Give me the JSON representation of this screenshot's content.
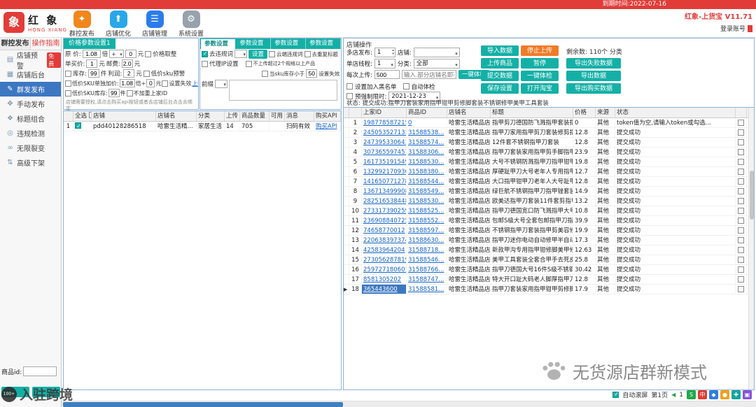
{
  "titlebar": {
    "expiry": "到期时间:2022-07-16",
    "version": "红象-上货宝 V11.71",
    "login": "登录账号"
  },
  "logo": {
    "glyph": "象",
    "title": "红 象",
    "sub": "HONG XIANG"
  },
  "toolbar": {
    "items": [
      {
        "label": "群控发布",
        "glyph": "✦",
        "color": "#f0861c"
      },
      {
        "label": "店铺优化",
        "glyph": "⬆",
        "color": "#29a7e8"
      },
      {
        "label": "店铺管理",
        "glyph": "☰",
        "color": "#2a7de8"
      },
      {
        "label": "系统设置",
        "glyph": "⚙",
        "color": "#97a2ad"
      }
    ]
  },
  "sidebar": {
    "tab1": "群控发布",
    "tab2": "操作指南",
    "items": [
      {
        "icon": "▤",
        "label": "店铺预警",
        "badge": "免费"
      },
      {
        "icon": "▦",
        "label": "店铺后台"
      },
      {
        "icon": "✎",
        "label": "群发发布",
        "selected": true
      },
      {
        "icon": "✥",
        "label": "手动发布"
      },
      {
        "icon": "❖",
        "label": "标题组合"
      },
      {
        "icon": "◎",
        "label": "违规检测"
      },
      {
        "icon": "∞",
        "label": "无限裂变"
      },
      {
        "icon": "⇅",
        "label": "高级下架"
      }
    ],
    "product_id_label": "商品id:"
  },
  "price_panel": {
    "tab": "价格参数设置1",
    "r1": {
      "label": "原 价:",
      "v1": "1.08",
      "u1": "倍",
      "op": "+",
      "v2": "0",
      "u2": "元",
      "cb": "价格取整"
    },
    "r2": {
      "label": "单买价:",
      "v1": "1",
      "u1": "元",
      "label2": "邮费:",
      "v2": "2.0",
      "u2": "元"
    },
    "r3": {
      "cb": "库存:",
      "v1": "99",
      "u1": "件",
      "label2": "利润:",
      "v2": "2",
      "u2": "元",
      "cb2": "低价sku预警"
    },
    "r4": {
      "cb": "低价SKU单独加价:",
      "v1": "1.08",
      "mid": "倍+",
      "v2": "0",
      "u2": "元",
      "cb2": "设置失效",
      "link": "上传"
    },
    "r5": {
      "cb": "低价SKU库存:",
      "v1": "99",
      "u1": "件",
      "cb2": "不加重上家ID"
    },
    "note": "店铺需要授权,请点击购买api按钮或者去店铺后台点击去绑定"
  },
  "params_panel": {
    "tabs": [
      {
        "label": "参数设置1",
        "selected": true
      },
      {
        "label": "参数设置2"
      },
      {
        "label": "参数设置3"
      },
      {
        "label": "参数设置4"
      }
    ],
    "cb_qwgc": "去违规词",
    "btn_set": "设置",
    "cb_cloud": "云端违规词",
    "cb_dedup": "去重复标题",
    "cb_proxy": "代理IP设置",
    "cb_limit": "不上传超过2个规格以上产品",
    "cb_sku": "当sku库存小于",
    "sku_v1": "50",
    "sku_mid": "设置失效",
    "sku_v2": "0",
    "prefix_label": "前缀"
  },
  "store_table": {
    "headers": [
      "全选",
      "店铺",
      "店铺名",
      "分类",
      "上传",
      "商品数量",
      "可用",
      "消息",
      "购买API"
    ],
    "rows": [
      {
        "store": "pdd40128286518",
        "name": "哈雷生活精...",
        "cat": "家居生活",
        "up": "14",
        "cnt": "705",
        "avail": "",
        "msg": "扫码有效",
        "api": "购买API",
        "checked": true
      }
    ]
  },
  "ops": {
    "title": "店铺操作",
    "r1_label": "多店发布:",
    "r1_value": "1",
    "r1_label2": "店铺:",
    "r2_label": "单店线程:",
    "r2_value": "1",
    "r2_label2": "分类:",
    "r2_value2": "全部",
    "r3_label": "每次上传:",
    "r3_value": "500",
    "r3_placeholder": "输入.部分店铺名即可",
    "r3_btn": "一键体检",
    "cb_blacklist": "设置加入黑名单",
    "cb_autocheck": "自动体检",
    "cb_presale": "预强制限时:",
    "presale_date": "2021-12-23",
    "remaining": "剩余数: 110个  分类",
    "grid_buttons": [
      {
        "label": "导入数据"
      },
      {
        "label": "停止上传",
        "orange": true
      },
      {
        "label": "上传商品"
      },
      {
        "label": "暂停"
      },
      {
        "label": "提交数据"
      },
      {
        "label": "一键体检"
      },
      {
        "label": "保存设置"
      },
      {
        "label": "打开淘宝"
      }
    ],
    "export_buttons": [
      {
        "label": "导出失败数据"
      },
      {
        "label": "导出数据"
      },
      {
        "label": "导出购买数据"
      }
    ],
    "status": "状态:  提交成功:指甲刀套装家用指甲钳甲剪修脚套装不锈钢修甲美甲工具套装"
  },
  "products": {
    "headers": [
      "上家ID",
      "商品ID",
      "店铺名",
      "标题",
      "价格",
      "来源",
      "状态"
    ],
    "rows": [
      {
        "sid": "198778587215",
        "pid": "0",
        "store": "哈雷生活精品店",
        "title": "指甲剪刀德国防飞溅指甲套装指甲...",
        "price": "0",
        "source": "其他",
        "status": "token值为空,请输入token或勾选..."
      },
      {
        "sid": "245053527133",
        "pid": "31588538...",
        "store": "哈雷生活精品店",
        "title": "指甲刀家用指甲剪刀套装修剪指甲...",
        "price": "12.8",
        "source": "其他",
        "status": "提交成功"
      },
      {
        "sid": "247395330641",
        "pid": "31588574...",
        "store": "哈雷生活精品店",
        "title": "12件套不锈钢指甲刀套装",
        "price": "12.8",
        "source": "其他",
        "status": "提交成功"
      },
      {
        "sid": "307365597457",
        "pid": "31588306...",
        "store": "哈雷生活精品店",
        "title": "指甲刀套装家用指甲剪手脚指甲拉...",
        "price": "23.9",
        "source": "其他",
        "status": "提交成功"
      },
      {
        "sid": "161735191549",
        "pid": "31588530...",
        "store": "哈雷生活精品店",
        "title": "大号不锈钢防溅指甲刀指甲钳甲...",
        "price": "19.8",
        "source": "其他",
        "status": "提交成功"
      },
      {
        "sid": "132992170930",
        "pid": "31588380...",
        "store": "哈雷生活精品店",
        "title": "厚硬趾甲刀大号老年人专用指甲钳修...",
        "price": "12.7",
        "source": "其他",
        "status": "提交成功"
      },
      {
        "sid": "141650771278",
        "pid": "31588544...",
        "store": "哈雷生活精品店",
        "title": "大口指甲钳甲刀老年人大号趾甲...",
        "price": "12.8",
        "source": "其他",
        "status": "提交成功"
      },
      {
        "sid": "136713499908",
        "pid": "31588549...",
        "store": "哈雷生活精品店",
        "title": "绿巨航不锈钢指甲刀指甲锉套装...",
        "price": "14.9",
        "source": "其他",
        "status": "提交成功"
      },
      {
        "sid": "282516538448",
        "pid": "31588530...",
        "store": "哈雷生活精品店",
        "title": "欧美达指甲刀套装11件套剪指甲...",
        "price": "13.2",
        "source": "其他",
        "status": "提交成功"
      },
      {
        "sid": "273317390259",
        "pid": "31588525...",
        "store": "哈雷生活精品店",
        "title": "指甲刀德国宽口防飞溅指甲大号...",
        "price": "10.8",
        "source": "其他",
        "status": "提交成功"
      },
      {
        "sid": "236908840725",
        "pid": "31588552...",
        "store": "哈雷生活精品店",
        "title": "包邮S级大号全套包邮指甲刀指甲...",
        "price": "39.9",
        "source": "其他",
        "status": "提交成功"
      },
      {
        "sid": "74658770012",
        "pid": "31588597...",
        "store": "哈雷生活精品店",
        "title": "不锈钢指甲刀套装指甲剪美容修甲...",
        "price": "19.9",
        "source": "其他",
        "status": "提交成功"
      },
      {
        "sid": "220638397374",
        "pid": "31588630...",
        "store": "哈雷生活精品店",
        "title": "指甲刀迷你电动自动修甲半自动指...",
        "price": "17.3",
        "source": "其他",
        "status": "提交成功"
      },
      {
        "sid": "42583964204",
        "pid": "31588718...",
        "store": "哈雷生活精品店",
        "title": "新款甲沟专用指甲钳修脚美甲修复...",
        "price": "12.63",
        "source": "其他",
        "status": "提交成功"
      },
      {
        "sid": "273056287819",
        "pid": "31588546...",
        "store": "哈雷生活精品店",
        "title": "美甲工具套装全套合甲手去死皮剪...",
        "price": "25.8",
        "source": "其他",
        "status": "提交成功"
      },
      {
        "sid": "259727180601",
        "pid": "31588766...",
        "store": "哈雷生活精品店",
        "title": "指甲刀德国大号16件S级不锈钢指甲...",
        "price": "30.42",
        "source": "其他",
        "status": "提交成功"
      },
      {
        "sid": "8581305202",
        "pid": "31588747...",
        "store": "哈雷生活精品店",
        "title": "特大开口趾大码老人脚厚指甲刀剪...",
        "price": "12.8",
        "source": "其他",
        "status": "提交成功"
      },
      {
        "sid": "365443600",
        "pid": "31588581...",
        "store": "哈雷生活精品店",
        "title": "指甲刀套装家用指甲钳甲剪修脚套...",
        "price": "17.9",
        "source": "其他",
        "status": "提交成功",
        "sel": true,
        "marker": "▶"
      }
    ]
  },
  "bottom": {
    "auto_label": "自动滚屏",
    "page": "第1页",
    "nav_arrow": "◀",
    "nav_num": "1",
    "tray": [
      {
        "g": "S",
        "c": "#21a84a"
      },
      {
        "g": "中",
        "c": "#e03c31"
      },
      {
        "g": "◆",
        "c": "#2f7de1"
      },
      {
        "g": "●",
        "c": "#f2a11a"
      },
      {
        "g": "✚",
        "c": "#12a5a0"
      },
      {
        "g": "▣",
        "c": "#8753d8"
      }
    ]
  },
  "watermarks": {
    "left_badge": "100+",
    "left_text": "入驻跨境",
    "right_text": "无货源店群新模式"
  }
}
